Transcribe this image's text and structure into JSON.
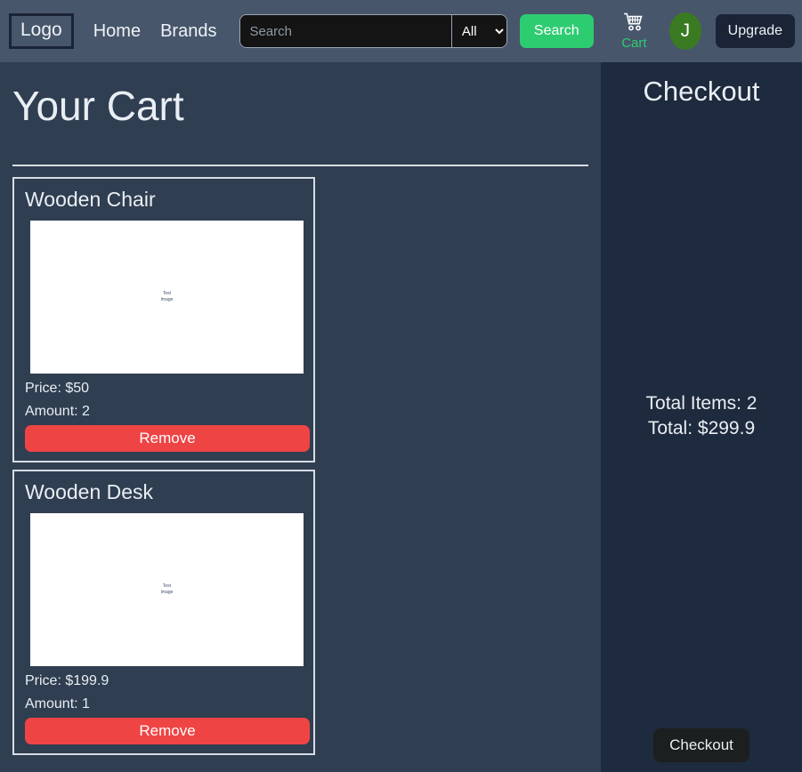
{
  "navbar": {
    "logo": "Logo",
    "links": [
      {
        "label": "Home",
        "name": "nav-link-home"
      },
      {
        "label": "Brands",
        "name": "nav-link-brands"
      }
    ],
    "search": {
      "placeholder": "Search",
      "value": "",
      "category_selected": "All",
      "category_options": [
        "All"
      ],
      "button_label": "Search"
    },
    "cart_label": "Cart",
    "avatar_initial": "J",
    "upgrade_label": "Upgrade"
  },
  "main": {
    "title": "Your Cart",
    "items": [
      {
        "name": "Wooden Chair",
        "image_alt": "Test Image",
        "price": "Price: $50",
        "amount": "Amount: 2",
        "remove_label": "Remove"
      },
      {
        "name": "Wooden Desk",
        "image_alt": "Test Image",
        "price": "Price: $199.9",
        "amount": "Amount: 1",
        "remove_label": "Remove"
      }
    ]
  },
  "checkout": {
    "title": "Checkout",
    "total_items": "Total Items: 2",
    "total_price": "Total: $299.9",
    "button_label": "Checkout"
  },
  "colors": {
    "navbar_bg": "#47566b",
    "content_bg": "#2f3e50",
    "sidebar_bg": "#1e2a3d",
    "accent_green": "#2ecc71",
    "danger_red": "#ef4444",
    "avatar_green": "#3a7a22",
    "upgrade_dark": "#1b2436"
  }
}
